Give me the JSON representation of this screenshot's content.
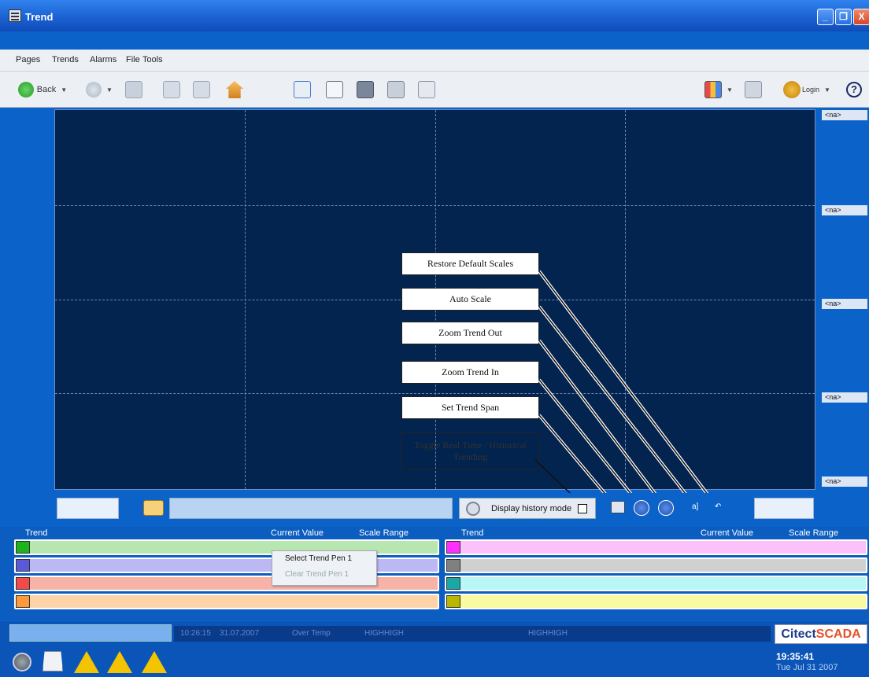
{
  "window": {
    "title": "Trend",
    "minimize": "_",
    "restore": "❐",
    "close": "X"
  },
  "menu": {
    "items": [
      "Pages",
      "Trends",
      "Alarms",
      "File",
      "Tools"
    ]
  },
  "toolbar": {
    "back_label": "Back",
    "login_label": "Login"
  },
  "scale_labels": [
    "<na>",
    "<na>",
    "<na>",
    "<na>",
    "<na>"
  ],
  "callouts": {
    "restore": "Restore Default Scales",
    "auto": "Auto Scale",
    "zoom_out": "Zoom Trend Out",
    "zoom_in": "Zoom Trend In",
    "span": "Set Trend Span",
    "toggle": "Toggle Real Time / Historical Trending"
  },
  "controls": {
    "history_label": "Display history mode"
  },
  "pens": {
    "left_headers": {
      "trend": "Trend",
      "current": "Current Value",
      "scale": "Scale Range"
    },
    "right_headers": {
      "trend": "Trend",
      "current": "Current Value",
      "scale": "Scale Range"
    },
    "left_colors": [
      "#1db31d",
      "#5a5ad8",
      "#f24a4a",
      "#ff9a3a"
    ],
    "left_fills": [
      "#b8e6b0",
      "#bcb8f4",
      "#f7b3a8",
      "#fcd4a8"
    ],
    "right_colors": [
      "#ff30ff",
      "#808080",
      "#1aa7a7",
      "#b8b800"
    ],
    "right_fills": [
      "#fbc2fa",
      "#d0d0d0",
      "#b9f6f6",
      "#fafaa0"
    ]
  },
  "context_menu": {
    "select": "Select Trend Pen 1",
    "clear": "Clear Trend Pen 1"
  },
  "status": {
    "alarm_time": "10:26:15",
    "alarm_date": "31.07.2007",
    "alarm_desc": "Over Temp",
    "alarm_state1": "HIGHHIGH",
    "alarm_state2": "HIGHHIGH",
    "logo_a": "Citect",
    "logo_b": "SCADA",
    "clock_time": "19:35:41",
    "clock_date": "Tue Jul 31 2007"
  }
}
